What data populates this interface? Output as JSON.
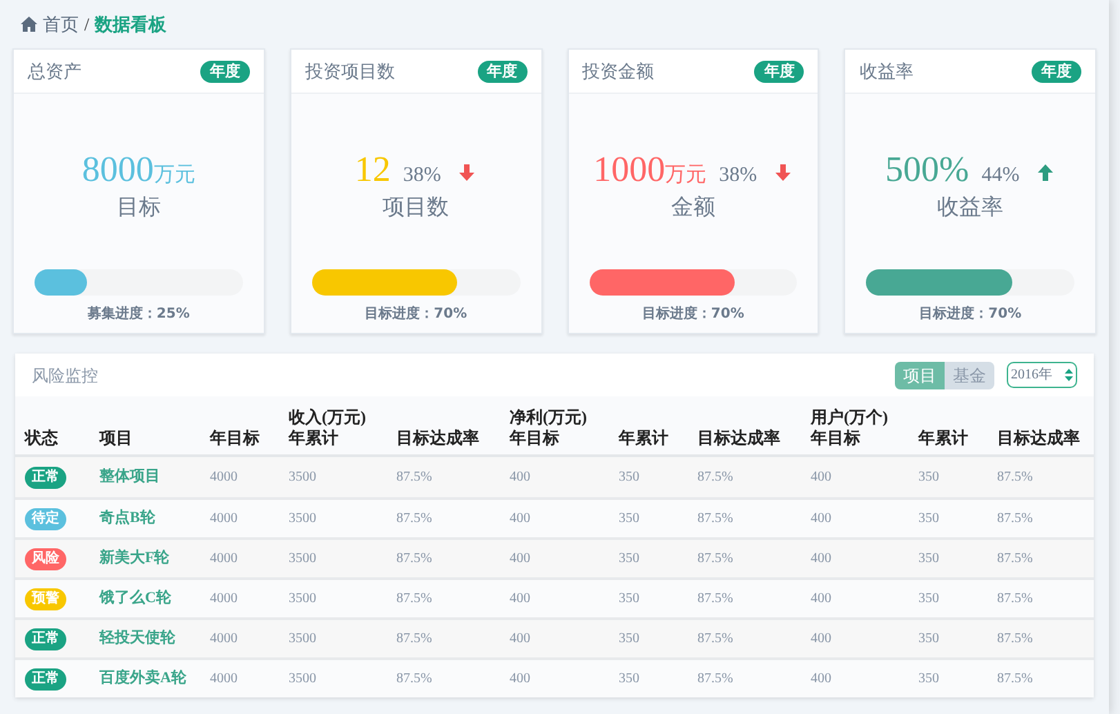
{
  "breadcrumb": {
    "home": "首页",
    "separator": "/",
    "current": "数据看板"
  },
  "cards": [
    {
      "title": "总资产",
      "badge": "年度",
      "value": "8000",
      "unit": "万元",
      "label": "目标",
      "color": "#5bc0de",
      "level": 0.25,
      "progress_text": "募集进度：25%"
    },
    {
      "title": "投资项目数",
      "badge": "年度",
      "value": "12",
      "change": "38%",
      "up": false,
      "label": "项目数",
      "color": "#f8c700",
      "level": 0.7,
      "progress_text": "目标进度：70%"
    },
    {
      "title": "投资金额",
      "badge": "年度",
      "value": "1000",
      "unit": "万元",
      "change": "38%",
      "up": false,
      "label": "金额",
      "color": "#ff6666",
      "level": 0.7,
      "progress_text": "目标进度：70%"
    },
    {
      "title": "收益率",
      "badge": "年度",
      "value": "500%",
      "change": "44%",
      "up": true,
      "label": "收益率",
      "color": "#48a894",
      "level": 0.7,
      "progress_text": "目标进度：70%"
    }
  ],
  "risk_panel": {
    "title": "风险监控",
    "toggle": [
      {
        "label": "项目",
        "selected": true
      },
      {
        "label": "基金",
        "selected": false
      }
    ],
    "year_select": {
      "value": "2016年"
    },
    "columns": [
      {
        "label": "状态"
      },
      {
        "label": "项目"
      },
      {
        "label": "年目标"
      },
      {
        "group": "收入(万元)",
        "label": "年累计"
      },
      {
        "label": "目标达成率"
      },
      {
        "group": "净利(万元)",
        "label": "年目标"
      },
      {
        "label": "年累计"
      },
      {
        "label": "目标达成率"
      },
      {
        "group": "用户(万个)",
        "label": "年目标"
      },
      {
        "label": "年累计"
      },
      {
        "label": "目标达成率"
      }
    ],
    "rows": [
      {
        "color": "#1aa383",
        "cells": [
          "正常",
          "整体项目",
          "4000",
          "3500",
          "87.5%",
          "400",
          "350",
          "87.5%",
          "400",
          "350",
          "87.5%"
        ]
      },
      {
        "color": "#5bc0de",
        "cells": [
          "待定",
          "奇点B轮",
          "4000",
          "3500",
          "87.5%",
          "400",
          "350",
          "87.5%",
          "400",
          "350",
          "87.5%"
        ]
      },
      {
        "color": "#ff6666",
        "cells": [
          "风险",
          "新美大F轮",
          "4000",
          "3500",
          "87.5%",
          "400",
          "350",
          "87.5%",
          "400",
          "350",
          "87.5%"
        ]
      },
      {
        "color": "#f8c700",
        "cells": [
          "预警",
          "饿了么C轮",
          "4000",
          "3500",
          "87.5%",
          "400",
          "350",
          "87.5%",
          "400",
          "350",
          "87.5%"
        ]
      },
      {
        "color": "#1aa383",
        "cells": [
          "正常",
          "轻投天使轮",
          "4000",
          "3500",
          "87.5%",
          "400",
          "350",
          "87.5%",
          "400",
          "350",
          "87.5%"
        ]
      },
      {
        "color": "#1aa383",
        "cells": [
          "正常",
          "百度外卖A轮",
          "4000",
          "3500",
          "87.5%",
          "400",
          "350",
          "87.5%",
          "400",
          "350",
          "87.5%"
        ]
      }
    ]
  }
}
